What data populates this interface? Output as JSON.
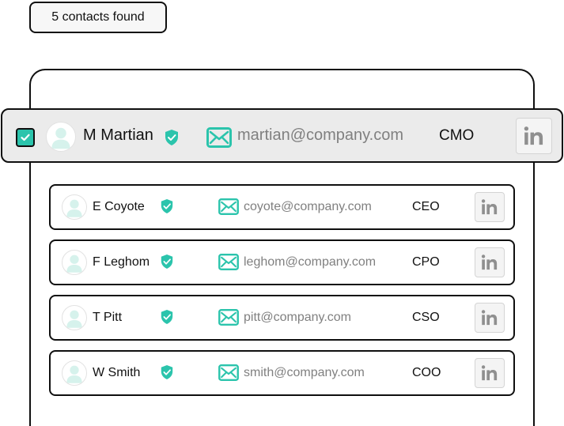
{
  "header": {
    "results_label": "5 contacts found"
  },
  "colors": {
    "accent": "#2bc4ac",
    "email_text": "#808080",
    "selected_row_bg": "#ebebeb",
    "border": "#0f0f0f"
  },
  "icons": {
    "checkbox": "checkmark-icon",
    "avatar": "user-avatar-icon",
    "verified": "shield-check-icon",
    "email": "envelope-icon",
    "social": "linkedin-icon"
  },
  "selected_contact": {
    "name": "M Martian",
    "email": "martian@company.com",
    "title": "CMO",
    "checked": true,
    "verified": true
  },
  "contacts": [
    {
      "name": "E Coyote",
      "email": "coyote@company.com",
      "title": "CEO",
      "verified": true
    },
    {
      "name": "F Leghom",
      "email": "leghom@company.com",
      "title": "CPO",
      "verified": true
    },
    {
      "name": "T Pitt",
      "email": "pitt@company.com",
      "title": "CSO",
      "verified": true
    },
    {
      "name": "W Smith",
      "email": "smith@company.com",
      "title": "COO",
      "verified": true
    }
  ]
}
